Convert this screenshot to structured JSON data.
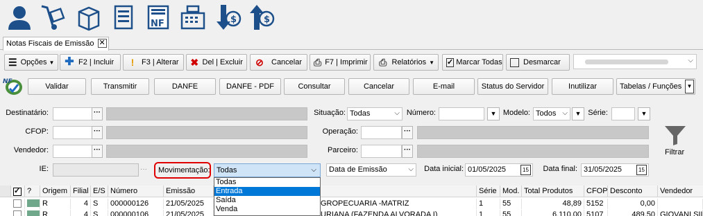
{
  "tab": {
    "label": "Notas Fiscais de Emissão",
    "close": "✕"
  },
  "toolbar": {
    "opcoes": "Opções",
    "incluir": "F2 | Incluir",
    "alterar": "F3 | Alterar",
    "excluir": "Del | Excluir",
    "cancelar": "Cancelar",
    "imprimir": "F7 | Imprimir",
    "relatorios": "Relatórios",
    "marcar_todas": "Marcar Todas",
    "desmarcar": "Desmarcar"
  },
  "actions": {
    "validar": "Validar",
    "transmitir": "Transmitir",
    "danfe": "DANFE",
    "danfe_pdf": "DANFE - PDF",
    "consultar": "Consultar",
    "cancelar": "Cancelar",
    "email": "E-mail",
    "status_servidor": "Status do Servidor",
    "inutilizar": "Inutilizar",
    "tabelas": "Tabelas / Funções"
  },
  "filters": {
    "destinatario": "Destinatário:",
    "cfop": "CFOP:",
    "vendedor": "Vendedor:",
    "ie": "IE:",
    "movimentacao_label": "Movimentação:",
    "movimentacao_value": "Todas",
    "situacao_label": "Situação:",
    "situacao_value": "Todas",
    "numero_label": "Número:",
    "modelo_label": "Modelo:",
    "modelo_value": "Todos",
    "serie_label": "Série:",
    "operacao_label": "Operação:",
    "parceiro_label": "Parceiro:",
    "data_tipo": "Data de Emissão",
    "data_inicial_label": "Data inicial:",
    "data_inicial": "01/05/2025",
    "data_final_label": "Data final:",
    "data_final": "31/05/2025",
    "filtrar": "Filtrar",
    "dots": "···"
  },
  "movimentacao_options": [
    "Todas",
    "Entrada",
    "Saída",
    "Venda"
  ],
  "movimentacao_highlighted": "Entrada",
  "grid": {
    "headers": {
      "q": "?",
      "origem": "Origem",
      "filial": "Filial",
      "es": "E/S",
      "numero": "Número",
      "emissao": "Emissão",
      "serie": "Série",
      "mod": "Mod.",
      "total": "Total Produtos",
      "cfop": "CFOP",
      "desconto": "Desconto",
      "vendedor": "Vendedor"
    },
    "rows": [
      {
        "origem": "R",
        "filial": "4",
        "es": "S",
        "numero": "000000126",
        "emissao": "21/05/2025",
        "nome": "GROPECUARIA -MATRIZ",
        "serie": "1",
        "mod": "55",
        "total": "48,89",
        "cfop": "5152",
        "desconto": "0,00",
        "vendedor": ""
      },
      {
        "origem": "R",
        "filial": "4",
        "es": "S",
        "numero": "000000106",
        "emissao": "21/05/2025",
        "nome": "URIANA (FAZENDA ALVORADA I)",
        "serie": "1",
        "mod": "55",
        "total": "6.110,00",
        "cfop": "5107",
        "desconto": "489,50",
        "vendedor": "GIOVANI SILV"
      }
    ]
  }
}
